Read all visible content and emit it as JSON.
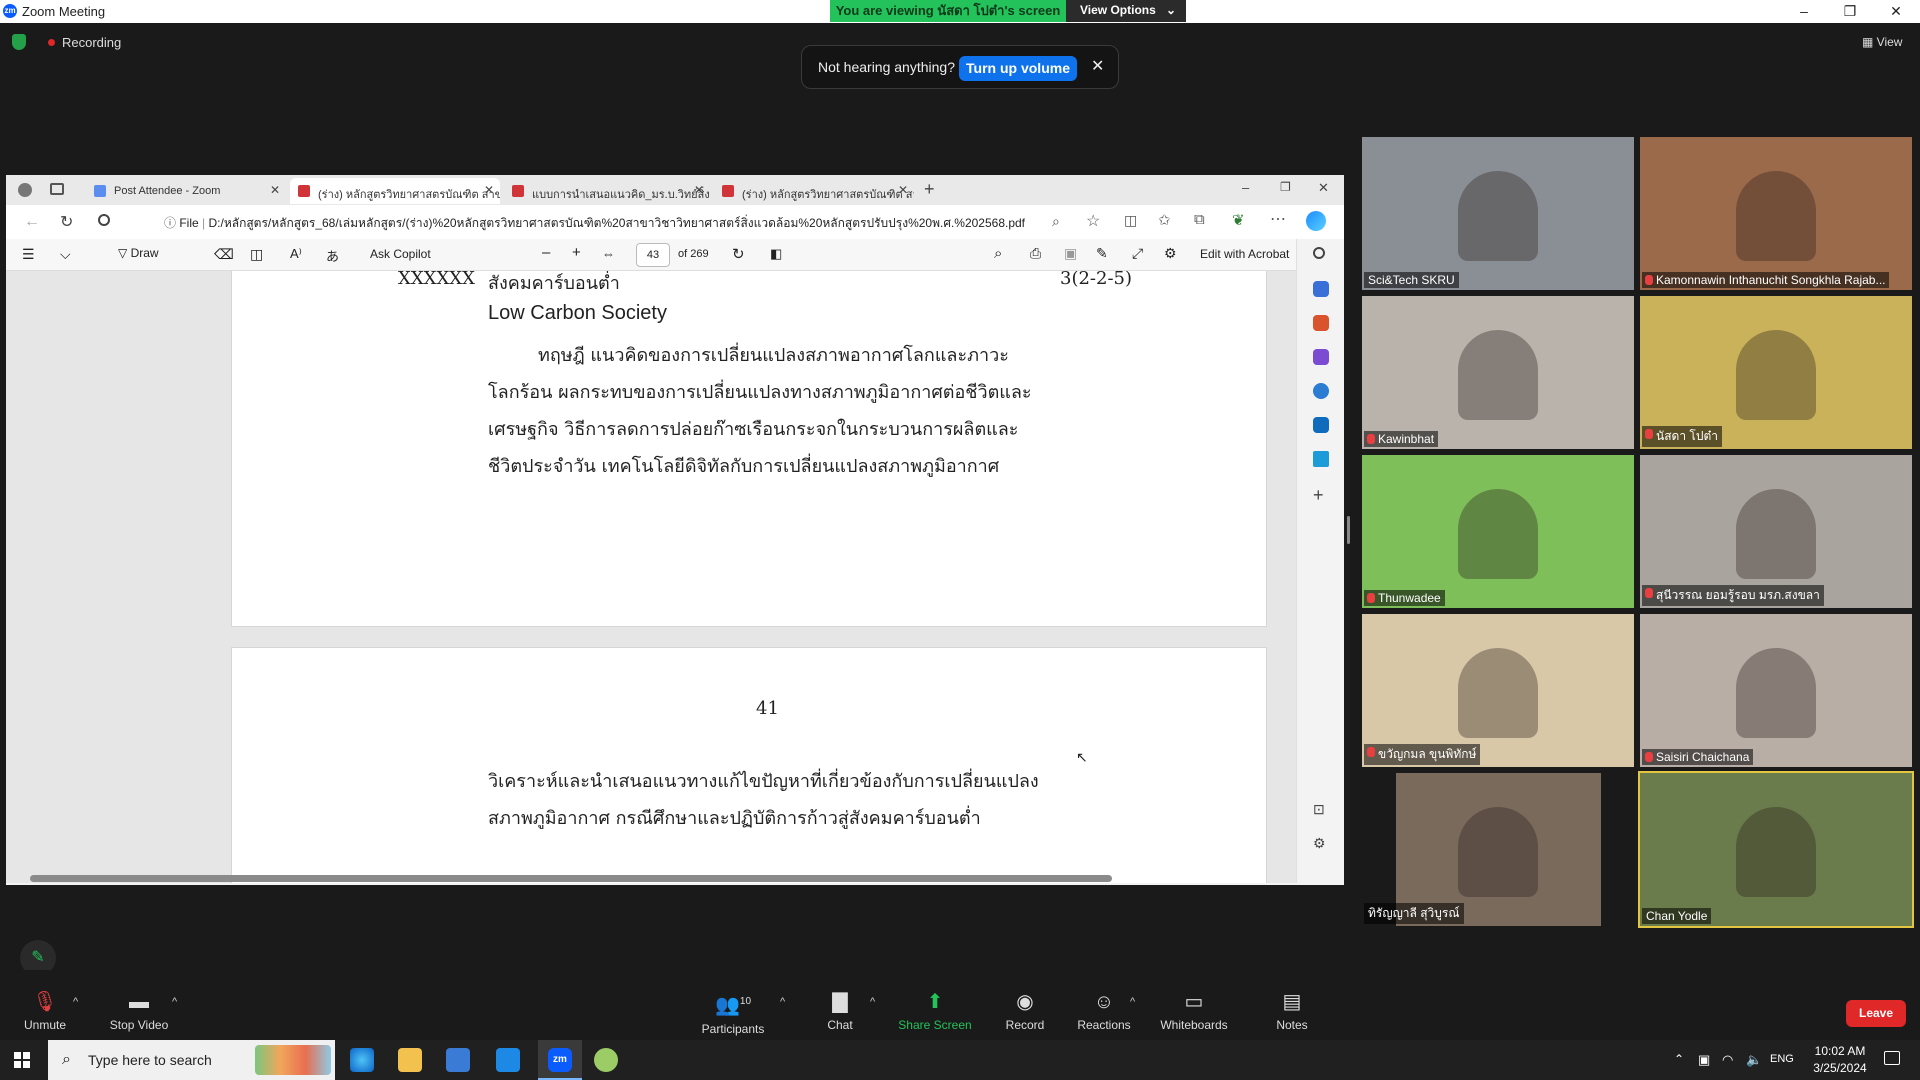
{
  "zoom": {
    "window_title": "Zoom Meeting",
    "viewing_banner": "You are viewing นัสดา โปต๋า's screen",
    "view_options": "View Options",
    "recording": "Recording",
    "view_label": "View",
    "popup": {
      "message": "Not hearing anything?",
      "button": "Turn up volume"
    }
  },
  "browser": {
    "tabs": [
      {
        "label": "Post Attendee - Zoom",
        "color": "#5b8def"
      },
      {
        "label": "(ร่าง) หลักสูตรวิทยาศาสตรบัณฑิต สาข",
        "color": "#d13438"
      },
      {
        "label": "แบบการนำเสนอแนวคิด_มร.บ.วิทย์สิ่งแว",
        "color": "#d13438"
      },
      {
        "label": "(ร่าง) หลักสูตรวิทยาศาสตรบัณฑิต สาข",
        "color": "#d13438"
      }
    ],
    "url_prefix": "File",
    "url": "D:/หลักสูตร/หลักสูตร_68/เล่มหลักสูตร/(ร่าง)%20หลักสูตรวิทยาศาสตรบัณฑิต%20สาขาวิชาวิทยาศาสตร์สิ่งแวดล้อม%20หลักสูตรปรับปรุง%20พ.ศ.%202568.pdf",
    "pdf_toolbar": {
      "draw": "Draw",
      "ask_copilot": "Ask Copilot",
      "page_number": "43",
      "page_total": "of 269",
      "edit_acrobat": "Edit with Acrobat"
    },
    "pdf": {
      "header_code": "XXXXXX",
      "header_title": "สังคมคาร์บอนต่ำ",
      "header_credits": "3(2-2-5)",
      "course_en": "Low Carbon Society",
      "paragraph": [
        "ทฤษฎี แนวคิดของการเปลี่ยนแปลงสภาพอากาศโลกและภาวะ",
        "โลกร้อน ผลกระทบของการเปลี่ยนแปลงทางสภาพภูมิอากาศต่อชีวิตและ",
        "เศรษฐกิจ วิธีการลดการปล่อยก๊าซเรือนกระจกในกระบวนการผลิตและ",
        "ชีวิตประจำวัน เทคโนโลยีดิจิทัลกับการเปลี่ยนแปลงสภาพภูมิอากาศ"
      ],
      "page2_number": "41",
      "page2_lines": [
        "วิเคราะห์และนำเสนอแนวทางแก้ไขปัญหาที่เกี่ยวข้องกับการเปลี่ยนแปลง",
        "สภาพภูมิอากาศ กรณีศึกษาและปฏิบัติการก้าวสู่สังคมคาร์บอนต่ำ"
      ]
    }
  },
  "participants_gallery": [
    {
      "name": "Sci&Tech SKRU",
      "muted": false,
      "bg": "#8a8f96"
    },
    {
      "name": "Kamonnawin Inthanuchit Songkhla Rajab...",
      "muted": true,
      "bg": "#9b6a4a"
    },
    {
      "name": "Kawinbhat",
      "muted": true,
      "bg": "#b9b3ab"
    },
    {
      "name": "นัสดา โปต๋า",
      "muted": true,
      "bg": "#c9b25a"
    },
    {
      "name": "Thunwadee",
      "muted": true,
      "bg": "#7fbf5a"
    },
    {
      "name": "สุนีวรรณ ยอมรู้รอบ มรภ.สงขลา",
      "muted": true,
      "bg": "#a9a59e"
    },
    {
      "name": "ขวัญกมล ขุนพิทักษ์",
      "muted": true,
      "bg": "#d9c8a8"
    },
    {
      "name": "Saisiri Chaichana",
      "muted": true,
      "bg": "#b8aea6"
    },
    {
      "name": "ทิรัญญาลี สุวิบูรณ์",
      "muted": false,
      "bg": "#7a6a5c"
    },
    {
      "name": "Chan Yodle",
      "muted": false,
      "bg": "#6b7c4c"
    }
  ],
  "controls": {
    "unmute": "Unmute",
    "stop_video": "Stop Video",
    "participants": "Participants",
    "participants_count": "10",
    "chat": "Chat",
    "share_screen": "Share Screen",
    "record": "Record",
    "reactions": "Reactions",
    "whiteboards": "Whiteboards",
    "notes": "Notes",
    "leave": "Leave"
  },
  "taskbar": {
    "search_placeholder": "Type here to search",
    "language": "ENG",
    "time": "10:02 AM",
    "date": "3/25/2024"
  }
}
